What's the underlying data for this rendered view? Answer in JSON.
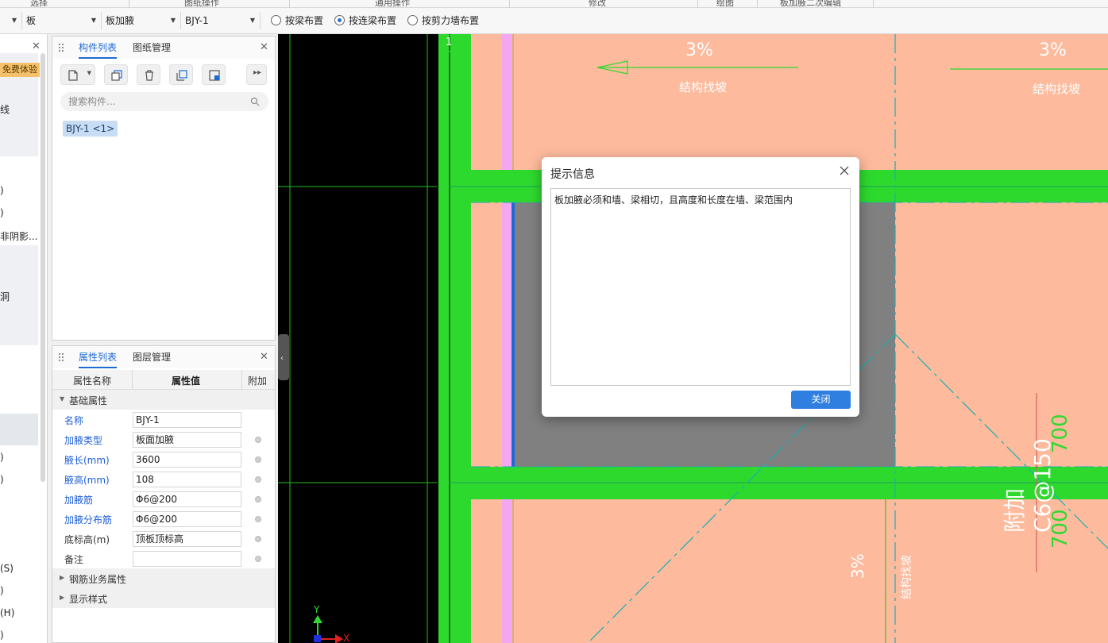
{
  "ribbon": {
    "captions": [
      "选择",
      "图纸操作",
      "通用操作",
      "修改",
      "绘图",
      "板加腋二次编辑"
    ]
  },
  "toolbar": {
    "combo1_value": "",
    "combo2_value": "板",
    "combo3_value": "板加腋",
    "combo4_value": "BJY-1",
    "radios": [
      {
        "label": "按梁布置",
        "checked": false
      },
      {
        "label": "按连梁布置",
        "checked": true
      },
      {
        "label": "按剪力墙布置",
        "checked": false
      }
    ]
  },
  "left_strip": {
    "badge": "免费体验",
    "lines": [
      "线",
      ")",
      ")",
      "非阴影...",
      "洞",
      ")",
      ")",
      "(S)",
      ")",
      "(H)",
      ")"
    ]
  },
  "component_panel": {
    "tabs": [
      "构件列表",
      "图纸管理"
    ],
    "search_placeholder": "搜索构件...",
    "items": [
      "BJY-1 <1>"
    ]
  },
  "property_panel": {
    "tabs": [
      "属性列表",
      "图层管理"
    ],
    "headers": {
      "name": "属性名称",
      "value": "属性值",
      "extra": "附加"
    },
    "section_basic": "基础属性",
    "rows": [
      {
        "name": "名称",
        "value": "BJY-1",
        "has_dot": false
      },
      {
        "name": "加腋类型",
        "value": "板面加腋",
        "has_dot": true
      },
      {
        "name": "腋长(mm)",
        "value": "3600",
        "has_dot": true
      },
      {
        "name": "腋高(mm)",
        "value": "108",
        "has_dot": true
      },
      {
        "name": "加腋筋",
        "value": "Φ6@200",
        "has_dot": true
      },
      {
        "name": "加腋分布筋",
        "value": "Φ6@200",
        "has_dot": true
      },
      {
        "name": "底标高(m)",
        "value": "顶板顶标高",
        "has_dot": true
      },
      {
        "name": "备注",
        "value": "",
        "has_dot": true
      }
    ],
    "section_rebar": "钢筋业务属性",
    "section_display": "显示样式"
  },
  "canvas": {
    "axis_number": "1",
    "slope_labels": [
      "3%",
      "3%",
      "3%"
    ],
    "slope_notes": [
      "结构找坡",
      "结构找坡",
      "结构找坡"
    ],
    "rebar_text": "附加C6@150",
    "dims": [
      "700",
      "700"
    ],
    "axis_y": "Y",
    "axis_x": "X"
  },
  "dialog": {
    "title": "提示信息",
    "message": "板加腋必须和墙、梁相切，且高度和长度在墙、梁范围内",
    "close_button": "关闭"
  },
  "colors": {
    "accent": "#1d6ad6",
    "beam_green": "#2ed92e",
    "slab_salmon": "#fdba9d",
    "haunch_gray": "#808080",
    "axis_line": "#1aa8a8"
  }
}
